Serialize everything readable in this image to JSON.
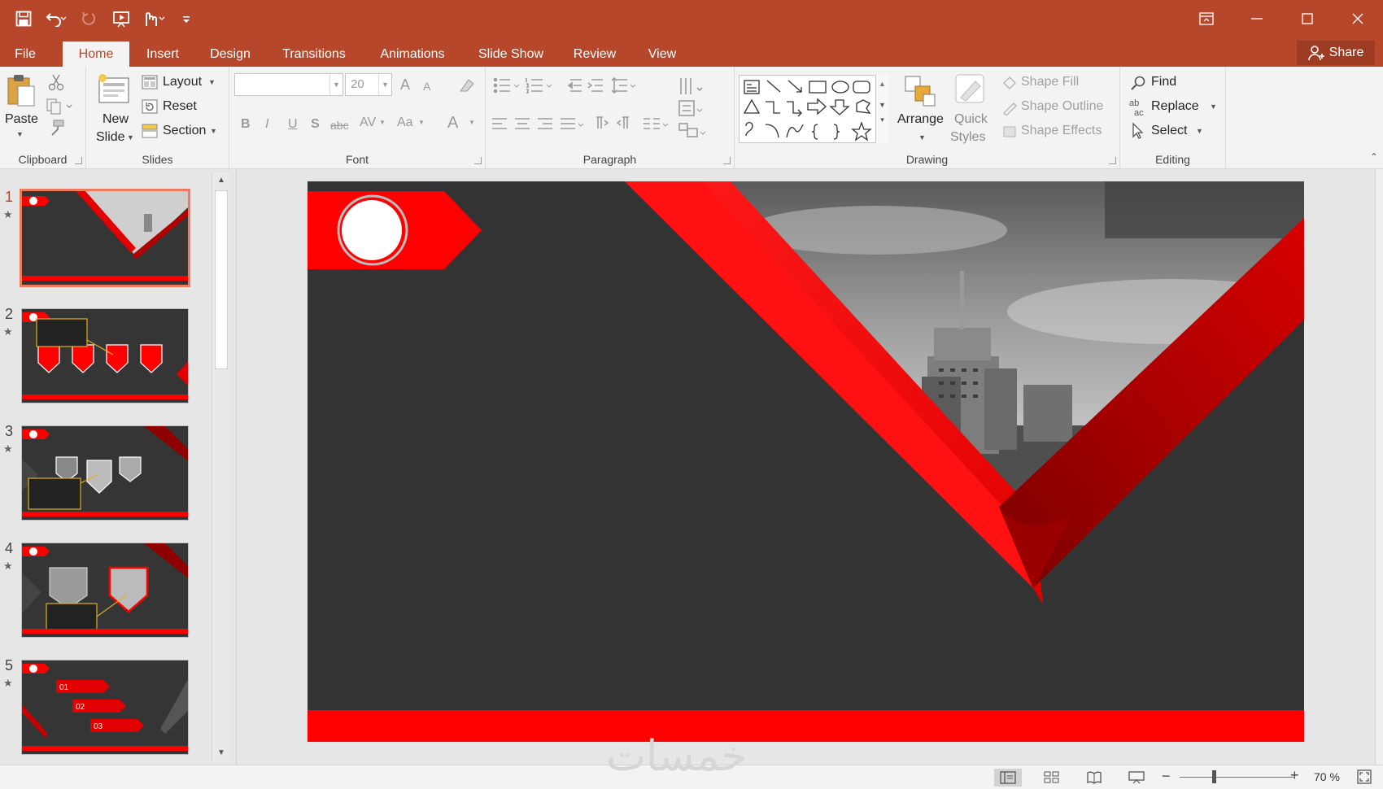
{
  "qat": {
    "icons": [
      "save-icon",
      "undo-icon",
      "redo-icon",
      "start-from-beginning-icon",
      "touch-mode-icon",
      "customize-icon"
    ]
  },
  "window_controls": {
    "icons": [
      "ribbon-display-options-icon",
      "minimize-icon",
      "maximize-icon",
      "close-icon"
    ]
  },
  "tabs": [
    "File",
    "Home",
    "Insert",
    "Design",
    "Transitions",
    "Animations",
    "Slide Show",
    "Review",
    "View"
  ],
  "active_tab": "Home",
  "share_label": "Share",
  "ribbon": {
    "clipboard": {
      "paste": "Paste",
      "label": "Clipboard"
    },
    "slides": {
      "new_slide_1": "New",
      "new_slide_2": "Slide",
      "layout": "Layout",
      "reset": "Reset",
      "section": "Section",
      "label": "Slides"
    },
    "font": {
      "name_value": "",
      "size_value": "20",
      "bold": "B",
      "italic": "I",
      "underline": "U",
      "shadow": "S",
      "strike": "abc",
      "spacing": "AV",
      "case": "Aa",
      "color": "A",
      "grow": "A",
      "shrink": "A",
      "label": "Font"
    },
    "paragraph": {
      "label": "Paragraph"
    },
    "drawing": {
      "arrange": "Arrange",
      "quick_styles_1": "Quick",
      "quick_styles_2": "Styles",
      "shape_fill": "Shape Fill",
      "shape_outline": "Shape Outline",
      "shape_effects": "Shape Effects",
      "label": "Drawing"
    },
    "editing": {
      "find": "Find",
      "replace": "Replace",
      "select": "Select",
      "label": "Editing"
    }
  },
  "thumbnails": [
    {
      "number": "1",
      "selected": true
    },
    {
      "number": "2",
      "selected": false
    },
    {
      "number": "3",
      "selected": false
    },
    {
      "number": "4",
      "selected": false
    },
    {
      "number": "5",
      "selected": false
    }
  ],
  "thumb5_labels": [
    "01",
    "02",
    "03"
  ],
  "colors": {
    "accent": "#b7472a",
    "slide_bg": "#333333",
    "slide_red": "#ff0000",
    "selection": "#f07a5e"
  },
  "status": {
    "zoom": "70 %",
    "minus": "−",
    "plus": "+"
  },
  "watermark": "خمسات"
}
